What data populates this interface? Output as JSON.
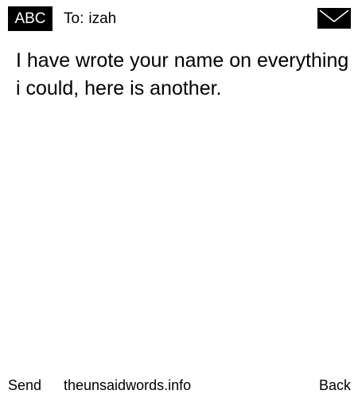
{
  "header": {
    "mode_badge": "ABC",
    "recipient_label": "To:",
    "recipient_name": "izah",
    "envelope_icon": "envelope-icon"
  },
  "message": {
    "body": "I have wrote your name on everything i could, here is another."
  },
  "footer": {
    "send_label": "Send",
    "site_label": "theunsaidwords.info",
    "back_label": "Back"
  },
  "colors": {
    "background": "#ffffff",
    "text": "#000000",
    "badge_background": "#000000",
    "badge_text": "#ffffff"
  }
}
